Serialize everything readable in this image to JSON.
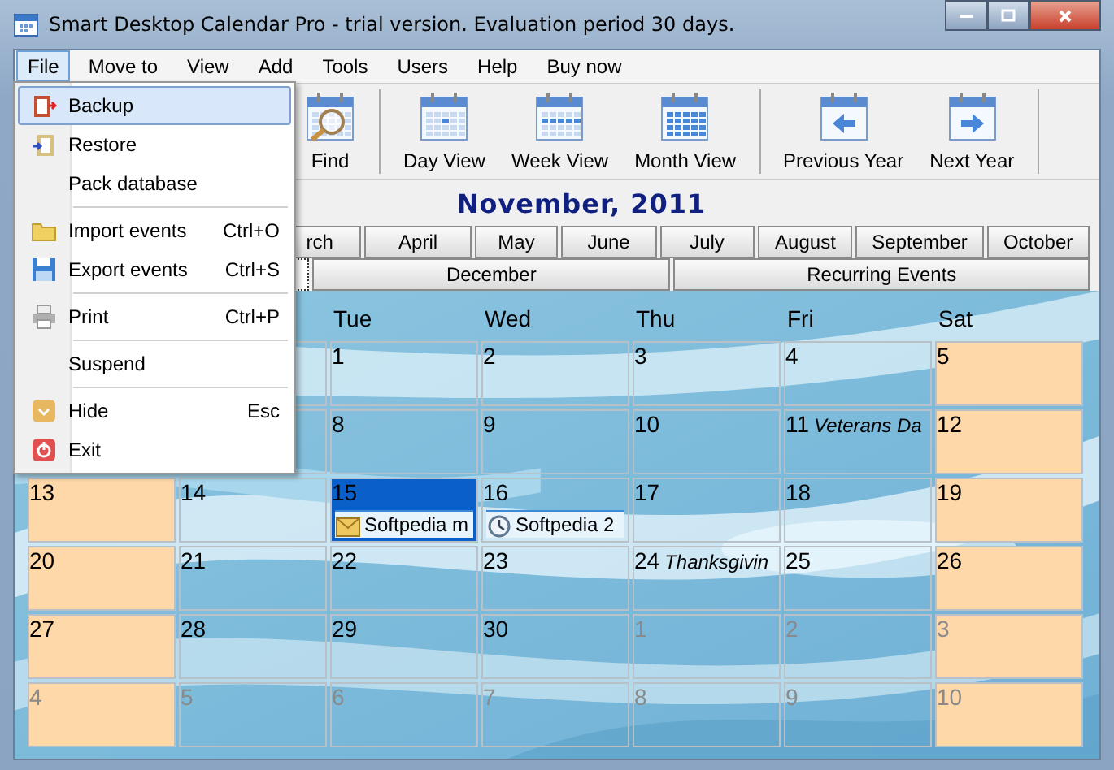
{
  "window": {
    "title": "Smart Desktop Calendar Pro - trial version. Evaluation period 30 days."
  },
  "menu_bar": [
    {
      "label": "File",
      "selected": true
    },
    {
      "label": "Move to",
      "selected": false
    },
    {
      "label": "View",
      "selected": false
    },
    {
      "label": "Add",
      "selected": false
    },
    {
      "label": "Tools",
      "selected": false
    },
    {
      "label": "Users",
      "selected": false
    },
    {
      "label": "Help",
      "selected": false
    },
    {
      "label": "Buy now",
      "selected": false
    }
  ],
  "file_menu": [
    {
      "kind": "item",
      "label": "Backup",
      "selected": true
    },
    {
      "kind": "item",
      "label": "Restore",
      "selected": false
    },
    {
      "kind": "item",
      "label": "Pack database",
      "selected": false
    },
    {
      "kind": "separator"
    },
    {
      "kind": "item",
      "label": "Import events",
      "shortcut": "Ctrl+O",
      "selected": false
    },
    {
      "kind": "item",
      "label": "Export events",
      "shortcut": "Ctrl+S",
      "selected": false
    },
    {
      "kind": "separator"
    },
    {
      "kind": "item",
      "label": "Print",
      "shortcut": "Ctrl+P",
      "selected": false
    },
    {
      "kind": "separator"
    },
    {
      "kind": "item",
      "label": "Suspend",
      "selected": false
    },
    {
      "kind": "separator"
    },
    {
      "kind": "item",
      "label": "Hide",
      "shortcut": "Esc",
      "selected": false
    },
    {
      "kind": "item",
      "label": "Exit",
      "selected": false
    }
  ],
  "toolbar": [
    {
      "kind": "find",
      "label": "Find"
    },
    {
      "kind": "separator"
    },
    {
      "kind": "day",
      "label": "Day View"
    },
    {
      "kind": "week",
      "label": "Week View"
    },
    {
      "kind": "month",
      "label": "Month View"
    },
    {
      "kind": "separator"
    },
    {
      "kind": "prev",
      "label": "Previous Year"
    },
    {
      "kind": "next",
      "label": "Next Year"
    },
    {
      "kind": "separator"
    }
  ],
  "month_title": "November, 2011",
  "month_tabs": [
    [
      {
        "label": "rch",
        "selected": false
      },
      {
        "label": "April",
        "selected": false
      },
      {
        "label": "May",
        "selected": false
      },
      {
        "label": "June",
        "selected": false
      },
      {
        "label": "July",
        "selected": false
      },
      {
        "label": "August",
        "selected": false
      },
      {
        "label": "September",
        "selected": false
      },
      {
        "label": "October",
        "selected": false
      }
    ],
    [
      {
        "selected": true
      },
      {
        "label": "December",
        "selected": false
      },
      {
        "label": "Recurring Events",
        "selected": false
      }
    ]
  ],
  "calendar": {
    "day_headers": [
      "Tue",
      "Wed",
      "Thu",
      "Fri",
      "Sat"
    ],
    "weeks": [
      [
        {
          "day": "1",
          "weekend": false,
          "selected": false,
          "other_month": false
        },
        {
          "day": "2",
          "weekend": false,
          "selected": false,
          "other_month": false
        },
        {
          "day": "3",
          "weekend": false,
          "selected": false,
          "other_month": false
        },
        {
          "day": "4",
          "weekend": false,
          "selected": false,
          "other_month": false
        },
        {
          "day": "5",
          "weekend": true,
          "selected": false,
          "other_month": false
        }
      ],
      [
        {
          "day": "8",
          "weekend": false,
          "selected": false,
          "other_month": false
        },
        {
          "day": "9",
          "weekend": false,
          "selected": false,
          "other_month": false
        },
        {
          "day": "10",
          "weekend": false,
          "selected": false,
          "other_month": false
        },
        {
          "day": "11",
          "holiday": "Veterans Da",
          "weekend": false,
          "selected": false,
          "other_month": false
        },
        {
          "day": "12",
          "weekend": true,
          "selected": false,
          "other_month": false
        }
      ],
      [
        {
          "day": "13",
          "weekend": true,
          "selected": false,
          "other_month": false
        },
        {
          "day": "14",
          "weekend": false,
          "selected": false,
          "other_month": false
        },
        {
          "day": "15",
          "weekend": false,
          "selected": true,
          "other_month": false,
          "events": [
            {
              "kind": "mail",
              "title": "Softpedia m"
            }
          ]
        },
        {
          "day": "16",
          "weekend": false,
          "selected": false,
          "other_month": false,
          "events": [
            {
              "kind": "clock",
              "title": "Softpedia 2"
            }
          ]
        },
        {
          "day": "17",
          "weekend": false,
          "selected": false,
          "other_month": false
        },
        {
          "day": "18",
          "weekend": false,
          "selected": false,
          "other_month": false
        },
        {
          "day": "19",
          "weekend": true,
          "selected": false,
          "other_month": false
        }
      ],
      [
        {
          "day": "20",
          "weekend": true,
          "selected": false,
          "other_month": false
        },
        {
          "day": "21",
          "weekend": false,
          "selected": false,
          "other_month": false
        },
        {
          "day": "22",
          "weekend": false,
          "selected": false,
          "other_month": false
        },
        {
          "day": "23",
          "weekend": false,
          "selected": false,
          "other_month": false
        },
        {
          "day": "24",
          "holiday": "Thanksgivin",
          "weekend": false,
          "selected": false,
          "other_month": false
        },
        {
          "day": "25",
          "weekend": false,
          "selected": false,
          "other_month": false
        },
        {
          "day": "26",
          "weekend": true,
          "selected": false,
          "other_month": false
        }
      ],
      [
        {
          "day": "27",
          "weekend": true,
          "selected": false,
          "other_month": false
        },
        {
          "day": "28",
          "weekend": false,
          "selected": false,
          "other_month": false
        },
        {
          "day": "29",
          "weekend": false,
          "selected": false,
          "other_month": false
        },
        {
          "day": "30",
          "weekend": false,
          "selected": false,
          "other_month": false
        },
        {
          "day": "1",
          "weekend": false,
          "selected": false,
          "other_month": true
        },
        {
          "day": "2",
          "weekend": false,
          "selected": false,
          "other_month": true
        },
        {
          "day": "3",
          "weekend": true,
          "selected": false,
          "other_month": true
        }
      ],
      [
        {
          "day": "4",
          "weekend": true,
          "selected": false,
          "other_month": true
        },
        {
          "day": "5",
          "weekend": false,
          "selected": false,
          "other_month": true
        },
        {
          "day": "6",
          "weekend": false,
          "selected": false,
          "other_month": true
        },
        {
          "day": "7",
          "weekend": false,
          "selected": false,
          "other_month": true
        },
        {
          "day": "8",
          "weekend": false,
          "selected": false,
          "other_month": true
        },
        {
          "day": "9",
          "weekend": false,
          "selected": false,
          "other_month": true
        },
        {
          "day": "10",
          "weekend": true,
          "selected": false,
          "other_month": true
        }
      ]
    ]
  }
}
